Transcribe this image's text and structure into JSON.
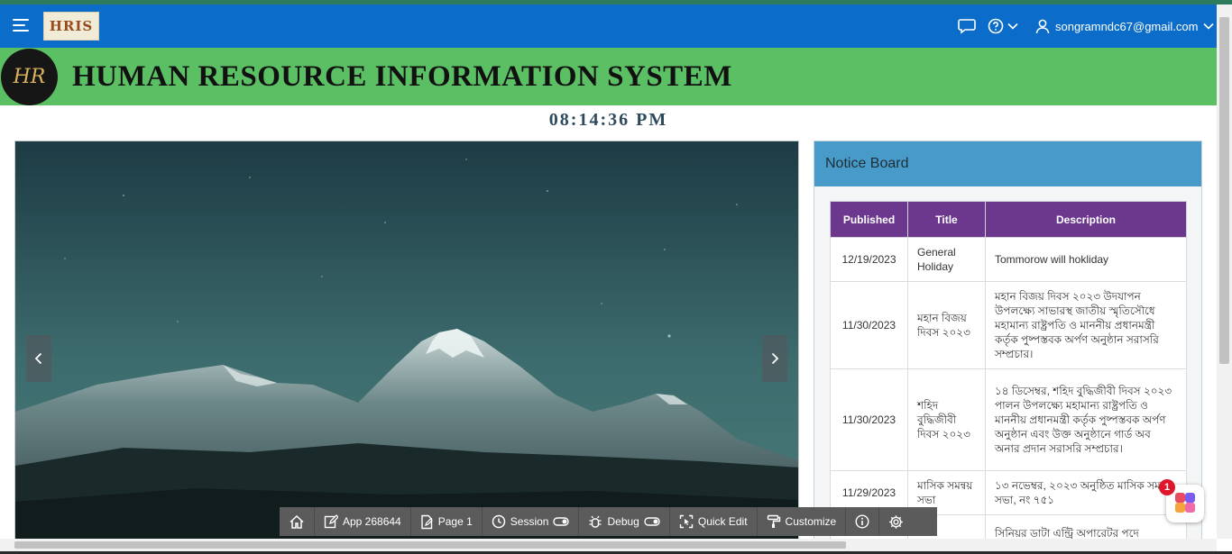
{
  "header": {
    "logo_text": "HRIS",
    "user_email": "songramndc67@gmail.com"
  },
  "banner": {
    "logo_text": "HR",
    "title": "HUMAN RESOURCE INFORMATION SYSTEM"
  },
  "clock": "08:14:36 PM",
  "notice_board": {
    "title": "Notice Board",
    "columns": [
      "Published",
      "Title",
      "Description"
    ],
    "rows": [
      {
        "published": "12/19/2023",
        "title": "General Holiday",
        "description": "Tommorow will hokliday"
      },
      {
        "published": "11/30/2023",
        "title": "মহান বিজয় দিবস ২০২৩",
        "description": "মহান বিজয় দিবস ২০২৩ উদযাপন উপলক্ষ্যে সাভারস্থ জাতীয় স্মৃতিসৌধে মহামান্য রাষ্ট্রপতি ও মাননীয় প্রধানমন্ত্রী কর্তৃক পুষ্পস্তবক অর্পণ অনুষ্ঠান সরাসরি সম্প্রচার।"
      },
      {
        "published": "11/30/2023",
        "title": "শহিদ বুদ্ধিজীবী দিবস ২০২৩",
        "description": "১৪ ডিসেম্বর, শহিদ বুদ্ধিজীবী দিবস ২০২৩ পালন উপলক্ষ্যে মহামান্য রাষ্ট্রপতি ও মাননীয় প্রধানমন্ত্রী কর্তৃক পুষ্পস্তবক অর্পণ অনুষ্ঠান এবং উক্ত অনুষ্ঠানে গার্ড অব অনার প্রদান সরাসরি সম্প্রচার।"
      },
      {
        "published": "11/29/2023",
        "title": "মাসিক সমন্বয় সভা",
        "description": "১৩ নভেম্বর, ২০২৩ অনুষ্ঠিত মাসিক সমন্বয় সভা, নং ৭৫১"
      },
      {
        "published": "",
        "title": "",
        "description": "সিনিয়র ডাটা এন্ট্রি অপারেটর পদে"
      }
    ]
  },
  "dev_toolbar": {
    "app": "App 268644",
    "page": "Page 1",
    "session": "Session",
    "debug": "Debug",
    "quick_edit": "Quick Edit",
    "customize": "Customize"
  },
  "fab": {
    "badge": "1"
  },
  "colors": {
    "header": "#0b6dc9",
    "banner": "#5bbf63",
    "notice_header": "#489bc9",
    "table_header": "#6b388d",
    "toolbar": "#5b5b5b"
  }
}
